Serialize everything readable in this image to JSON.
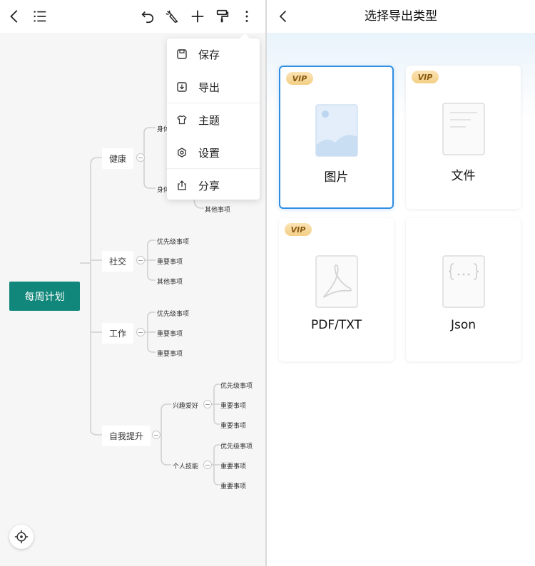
{
  "mindmap": {
    "root": "每周计划",
    "branches": {
      "health": {
        "label": "健康",
        "children": [
          "身体",
          "身体",
          "其他事项"
        ]
      },
      "social": {
        "label": "社交",
        "children": [
          "优先级事项",
          "重要事项",
          "其他事项"
        ]
      },
      "work": {
        "label": "工作",
        "children": [
          "优先级事项",
          "重要事项",
          "重要事项"
        ]
      },
      "self": {
        "label": "自我提升",
        "hobby": {
          "label": "兴趣爱好",
          "children": [
            "优先级事项",
            "重要事项",
            "重要事项"
          ]
        },
        "skills": {
          "label": "个人技能",
          "children": [
            "优先级事项",
            "重要事项",
            "重要事项"
          ]
        }
      }
    }
  },
  "menu": {
    "items": [
      {
        "label": "保存",
        "icon": "save-icon"
      },
      {
        "label": "导出",
        "icon": "export-icon"
      },
      {
        "label": "主题",
        "icon": "theme-icon"
      },
      {
        "label": "设置",
        "icon": "settings-icon"
      },
      {
        "label": "分享",
        "icon": "share-icon"
      }
    ]
  },
  "export": {
    "title": "选择导出类型",
    "options": [
      {
        "label": "图片",
        "vip": "VIP",
        "selected": true,
        "icon": "image-icon"
      },
      {
        "label": "文件",
        "vip": "VIP",
        "selected": false,
        "icon": "document-icon"
      },
      {
        "label": "PDF/TXT",
        "vip": "VIP",
        "selected": false,
        "icon": "pdf-icon"
      },
      {
        "label": "Json",
        "vip": "",
        "selected": false,
        "icon": "json-icon"
      }
    ]
  },
  "colors": {
    "root_node": "#10877a",
    "selected_border": "#2f8ee3",
    "vip_badge": "#f3cf86"
  }
}
